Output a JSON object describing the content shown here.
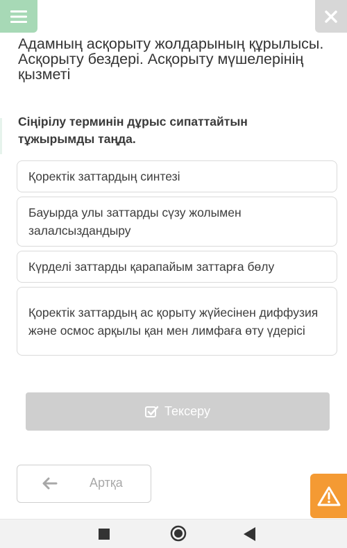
{
  "header": {
    "lesson_title": "Адамның асқорыту жолдарының құрылысы. Асқорыту бездері. Асқорыту мүшелерінің қызметі",
    "menu_icon": "hamburger-icon",
    "close_icon": "close-icon",
    "menu_color": "#a7d9b6",
    "close_color": "#d7d7d7"
  },
  "question": {
    "text": "Сіңірілу терминін дұрыс сипаттайтын тұжырымды таңда."
  },
  "options": [
    "Қоректік заттардың синтезі",
    "Бауырда улы заттарды сүзу жолымен залалсыздандыру",
    "Күрделі заттарды қарапайым заттарға бөлу",
    "Қоректік заттардың ас қорыту жүйесінен диффузия және осмос арқылы қан мен лимфаға өту үдерісі"
  ],
  "actions": {
    "check_label": "Тексеру",
    "check_icon": "checkbox-icon",
    "back_label": "Артқа",
    "back_icon": "arrow-left-icon",
    "report_icon": "warning-icon",
    "report_color": "#f49a33"
  },
  "system_nav": {
    "recents_icon": "square-icon",
    "home_icon": "circle-icon",
    "back_icon": "triangle-back-icon"
  }
}
